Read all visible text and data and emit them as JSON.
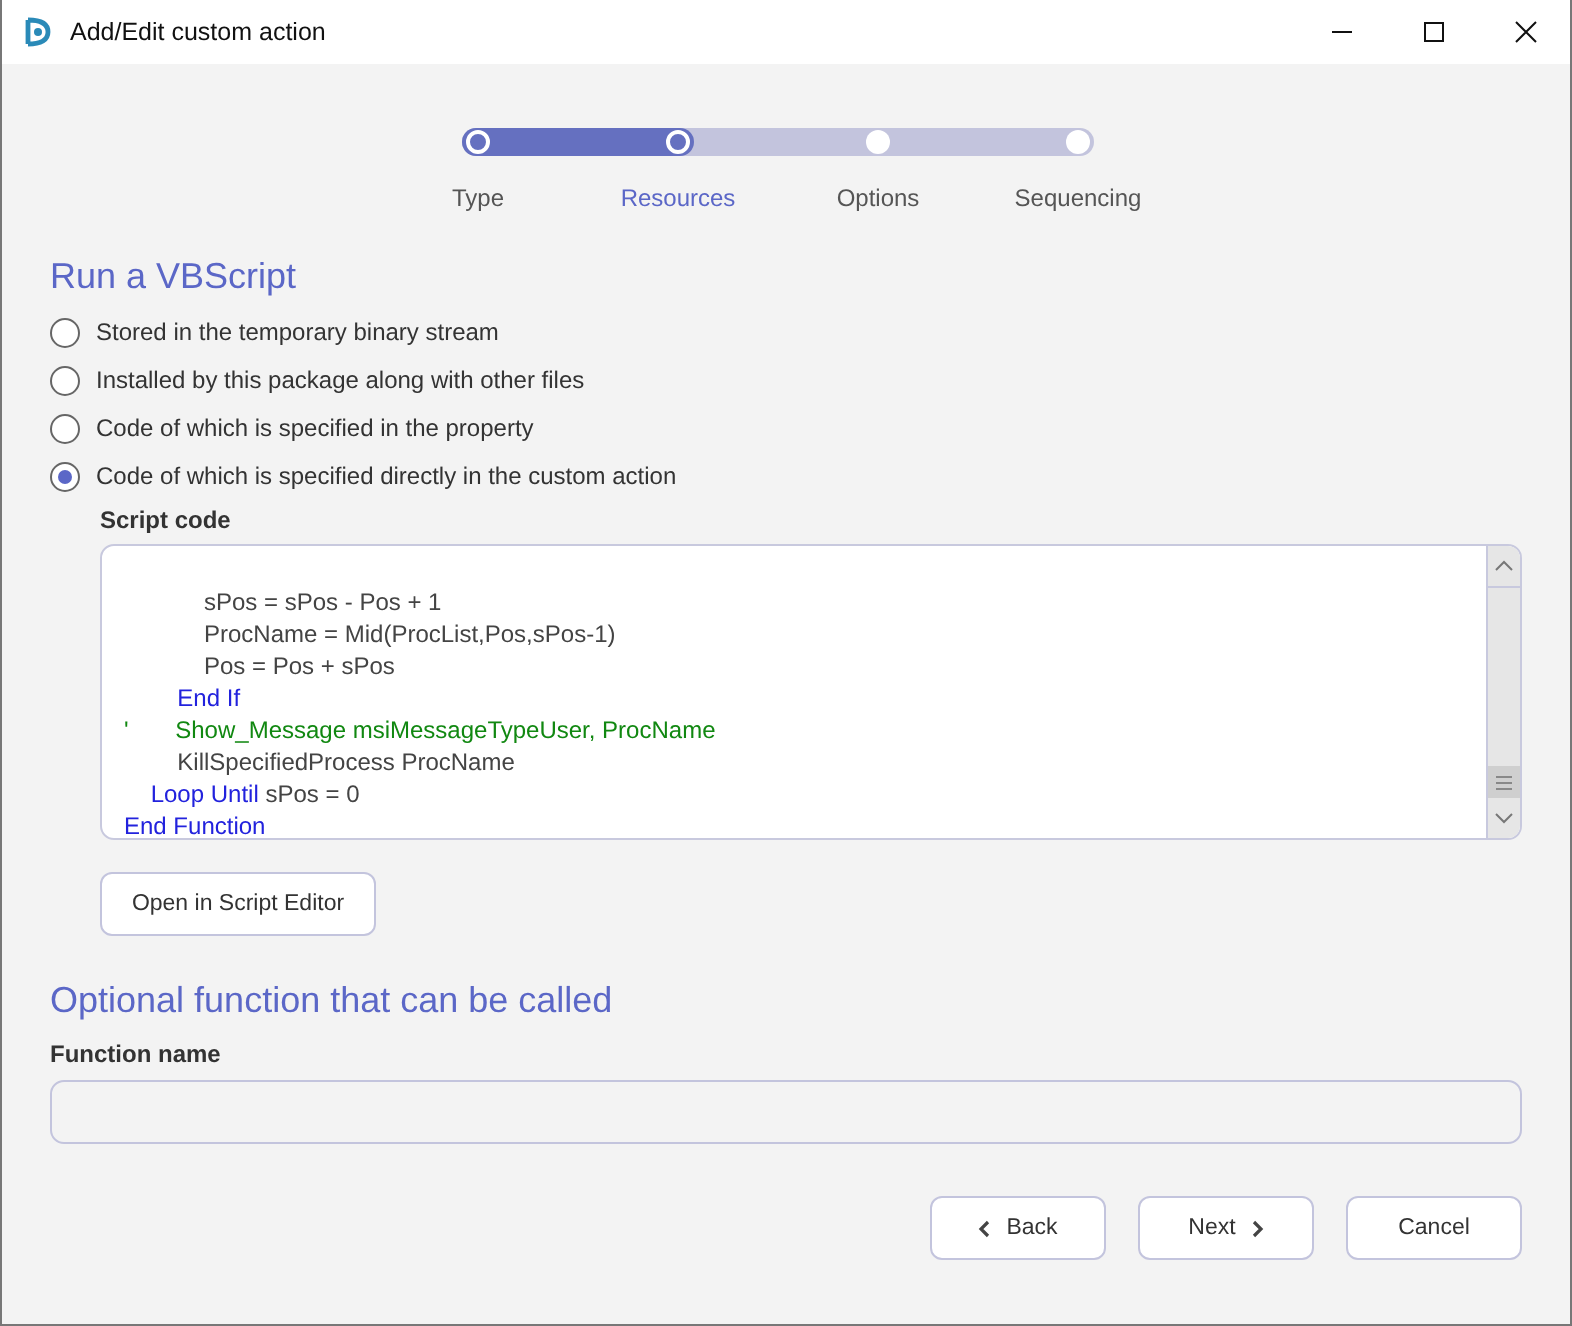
{
  "window": {
    "title": "Add/Edit custom action"
  },
  "steps": [
    {
      "label": "Type",
      "done": true,
      "selected": false
    },
    {
      "label": "Resources",
      "done": true,
      "selected": true
    },
    {
      "label": "Options",
      "done": false,
      "selected": false
    },
    {
      "label": "Sequencing",
      "done": false,
      "selected": false
    }
  ],
  "progress": {
    "level": 0.333
  },
  "heading": "Run a VBScript",
  "options": [
    {
      "label": "Stored in the temporary binary stream",
      "selected": false
    },
    {
      "label": "Installed by this package along with other files",
      "selected": false
    },
    {
      "label": "Code of which is specified in the property",
      "selected": false
    },
    {
      "label": "Code of which is specified directly in the custom action",
      "selected": true
    }
  ],
  "script": {
    "label": "Script code",
    "lines": [
      [
        {
          "kind": "plain",
          "text": "            sPos = sPos - Pos + 1"
        }
      ],
      [
        {
          "kind": "plain",
          "text": "            ProcName = Mid(ProcList,Pos,sPos-1)"
        }
      ],
      [
        {
          "kind": "plain",
          "text": "            Pos = Pos + sPos"
        }
      ],
      [
        {
          "kind": "keyword",
          "text": "        End If"
        }
      ],
      [
        {
          "kind": "comment",
          "text": "'       Show_Message msiMessageTypeUser, ProcName"
        }
      ],
      [
        {
          "kind": "plain",
          "text": "        KillSpecifiedProcess ProcName"
        }
      ],
      [
        {
          "kind": "keyword",
          "text": "    Loop Until"
        },
        {
          "kind": "plain",
          "text": " sPos = 0"
        }
      ],
      [
        {
          "kind": "keyword",
          "text": "End Function"
        }
      ]
    ]
  },
  "open_editor_button": "Open in Script Editor",
  "optional_heading": "Optional function that can be called",
  "function_name": {
    "label": "Function name"
  },
  "buttons": [
    {
      "kind": "back",
      "label": "Back"
    },
    {
      "kind": "next",
      "label": "Next"
    },
    {
      "kind": "cancel",
      "label": "Cancel"
    }
  ]
}
